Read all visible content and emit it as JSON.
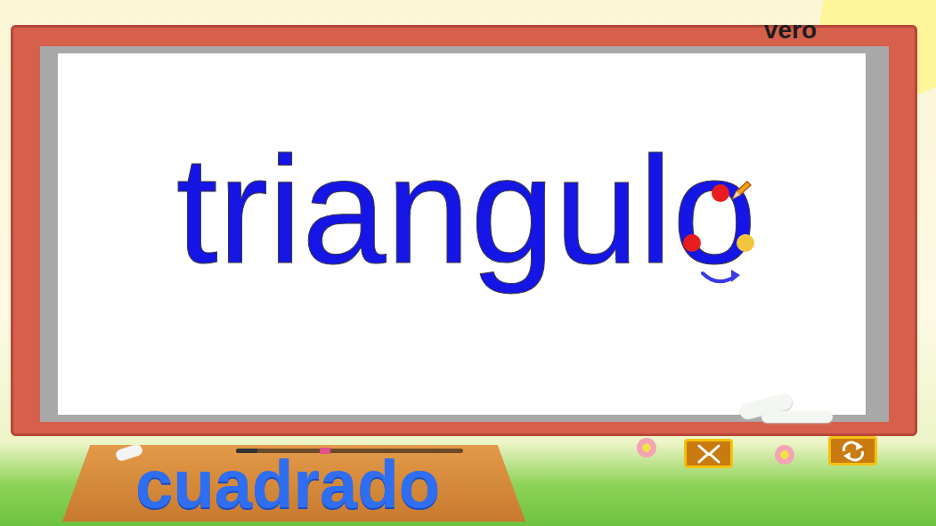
{
  "user": {
    "name": "vero"
  },
  "board": {
    "letters": [
      {
        "char": "t",
        "traced": true,
        "current": false
      },
      {
        "char": "r",
        "traced": true,
        "current": false
      },
      {
        "char": "i",
        "traced": true,
        "current": false
      },
      {
        "char": "a",
        "traced": true,
        "current": false
      },
      {
        "char": "n",
        "traced": true,
        "current": false
      },
      {
        "char": "g",
        "traced": true,
        "current": false
      },
      {
        "char": "u",
        "traced": true,
        "current": false
      },
      {
        "char": "l",
        "traced": true,
        "current": false
      },
      {
        "char": "o",
        "traced": true,
        "current": true
      }
    ]
  },
  "ledge": {
    "next_word": "cuadrado"
  }
}
